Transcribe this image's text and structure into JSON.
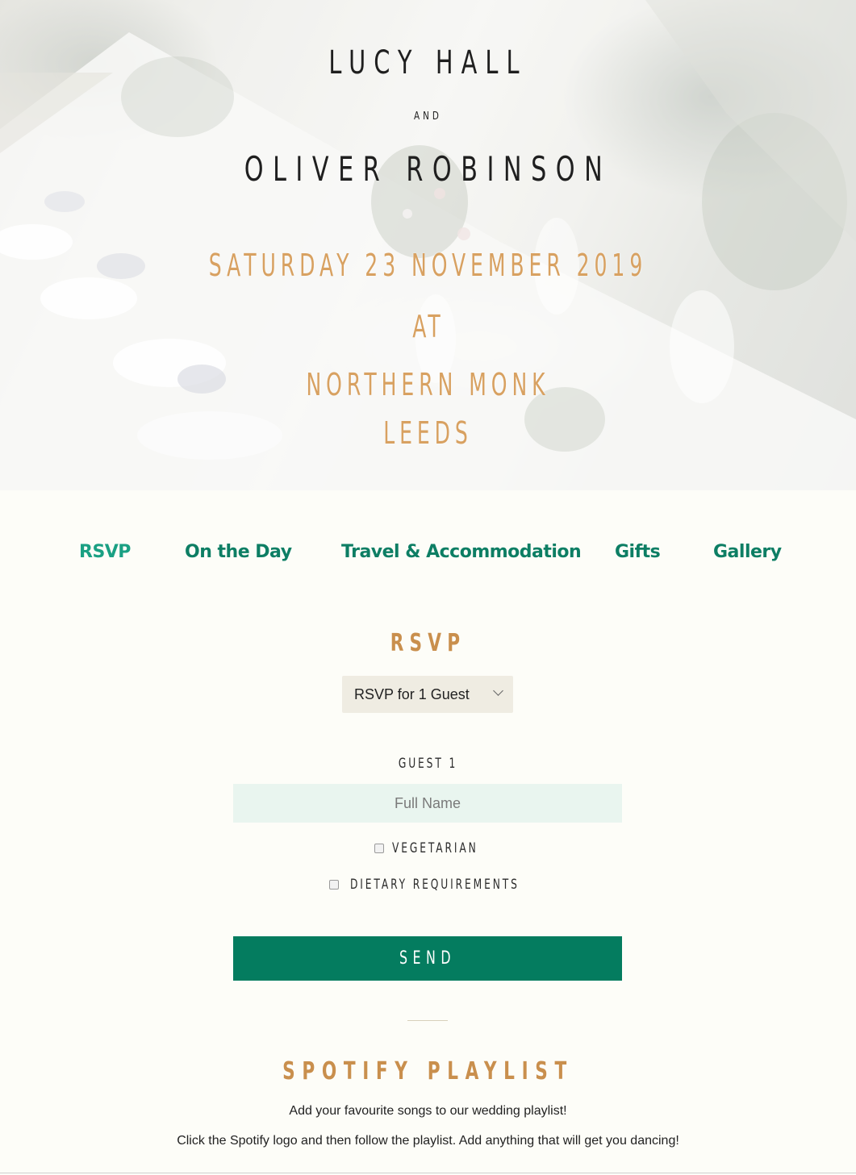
{
  "hero": {
    "name_one": "LUCY HALL",
    "conjunction": "AND",
    "name_two": "OLIVER ROBINSON",
    "date": "SATURDAY 23 NOVEMBER 2019",
    "at": "AT",
    "venue_line1": "NORTHERN MONK",
    "venue_line2": "LEEDS"
  },
  "nav": {
    "items": [
      {
        "label": "RSVP",
        "active": true
      },
      {
        "label": "On the Day",
        "active": false
      },
      {
        "label": "Travel & Accommodation",
        "active": false
      },
      {
        "label": "Gifts",
        "active": false
      },
      {
        "label": "Gallery",
        "active": false
      }
    ]
  },
  "rsvp": {
    "title": "RSVP",
    "guest_select": {
      "selected": "RSVP for 1 Guest"
    },
    "guest_label": "GUEST 1",
    "name_placeholder": "Full Name",
    "name_value": "",
    "options": [
      {
        "label": "VEGETARIAN",
        "checked": false
      },
      {
        "label": "DIETARY REQUIREMENTS",
        "checked": false
      }
    ],
    "send_label": "SEND"
  },
  "spotify": {
    "title": "SPOTIFY PLAYLIST",
    "line1": "Add your favourite songs to our wedding playlist!",
    "line2": "Click the Spotify logo and then follow the playlist. Add anything that will get you dancing!"
  },
  "colors": {
    "accent_green": "#047c5f",
    "nav_green": "#0d7e64",
    "gold": "#c98f4d",
    "page_bg": "#fdfdf8"
  }
}
